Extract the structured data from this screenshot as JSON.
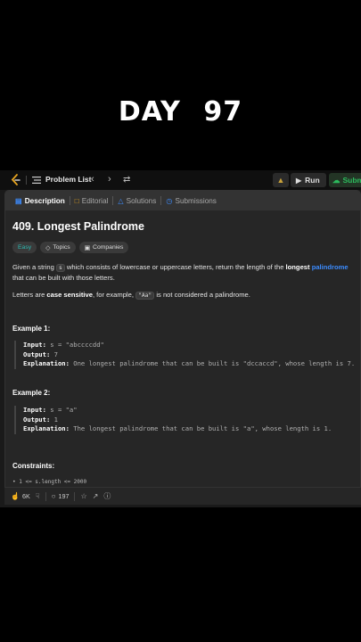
{
  "overlay": {
    "title": "DAY  97"
  },
  "topbar": {
    "problem_list_label": "Problem List",
    "prev_icon": "chevron-left-icon",
    "next_icon": "chevron-right-icon",
    "shuffle_icon": "shuffle-icon",
    "run_label": "Run",
    "submit_label": "Submit"
  },
  "tabs": [
    {
      "label": "Description",
      "icon": "description-icon",
      "active": true
    },
    {
      "label": "Editorial",
      "icon": "book-icon"
    },
    {
      "label": "Solutions",
      "icon": "flask-icon"
    },
    {
      "label": "Submissions",
      "icon": "clock-icon"
    }
  ],
  "problem": {
    "title": "409. Longest Palindrome",
    "badges": {
      "difficulty": "Easy",
      "topics": "Topics",
      "companies": "Companies"
    },
    "p1_a": "Given a string ",
    "p1_code": "s",
    "p1_b": " which consists of lowercase or uppercase letters, return the length of the ",
    "p1_bold": "longest",
    "p1_link": "palindrome",
    "p1_c": " that can be built with those letters.",
    "p2_a": "Letters are ",
    "p2_bold": "case sensitive",
    "p2_b": ", for example, ",
    "p2_code": "\"Aa\"",
    "p2_c": " is not considered a palindrome."
  },
  "examples": [
    {
      "heading": "Example 1:",
      "input_k": "Input:",
      "input_v": " s = \"abccccdd\"",
      "output_k": "Output:",
      "output_v": " 7",
      "expl_k": "Explanation:",
      "expl_v": " One longest palindrome that can be built is \"dccaccd\", whose length is 7."
    },
    {
      "heading": "Example 2:",
      "input_k": "Input:",
      "input_v": " s = \"a\"",
      "output_k": "Output:",
      "output_v": " 1",
      "expl_k": "Explanation:",
      "expl_v": " The longest palindrome that can be built is \"a\", whose length is 1."
    }
  ],
  "constraints": {
    "heading": "Constraints:",
    "line1": "1 <= s.length <= 2000"
  },
  "bottombar": {
    "likes": "6K",
    "comments": "197"
  }
}
